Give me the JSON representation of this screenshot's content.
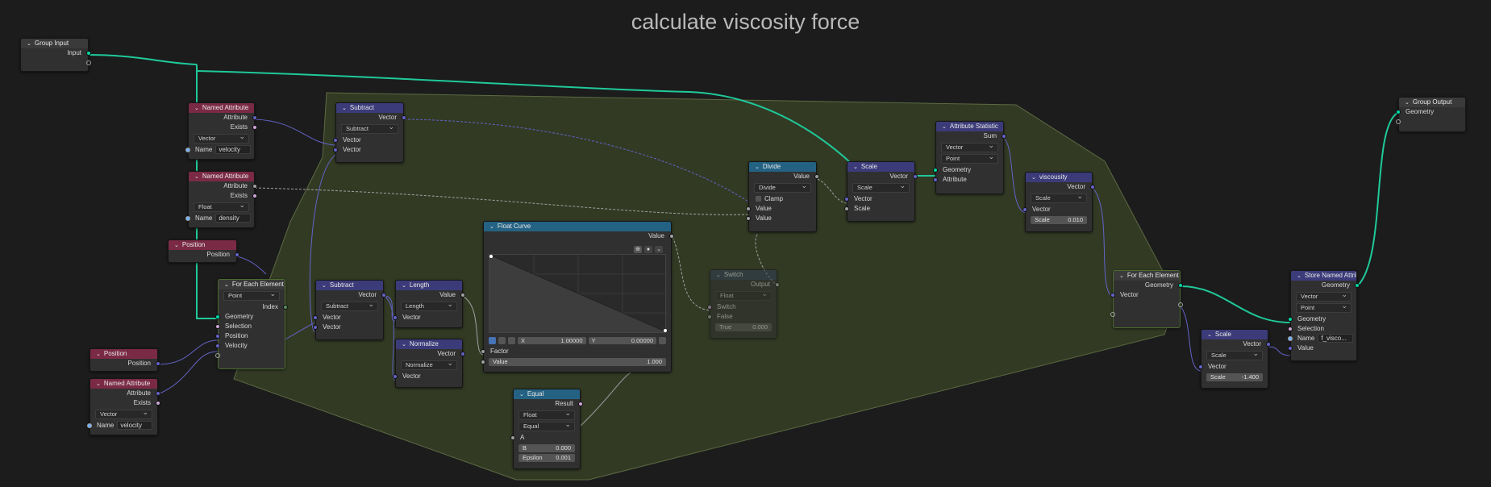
{
  "title": "calculate viscosity force",
  "nodes": {
    "group_input": {
      "header": "Group Input",
      "input_label": "Input"
    },
    "group_output": {
      "header": "Group Output",
      "geometry_label": "Geometry"
    },
    "named_attr_1": {
      "header": "Named Attribute",
      "attribute_label": "Attribute",
      "exists_label": "Exists",
      "type_value": "Vector",
      "name_label": "Name",
      "name_value": "velocity"
    },
    "named_attr_2": {
      "header": "Named Attribute",
      "attribute_label": "Attribute",
      "exists_label": "Exists",
      "type_value": "Float",
      "name_label": "Name",
      "name_value": "density"
    },
    "named_attr_3": {
      "header": "Named Attribute",
      "attribute_label": "Attribute",
      "exists_label": "Exists",
      "type_value": "Vector",
      "name_label": "Name",
      "name_value": "velocity"
    },
    "position_1": {
      "header": "Position",
      "position_label": "Position"
    },
    "position_2": {
      "header": "Position",
      "position_label": "Position"
    },
    "for_each_1": {
      "header": "For Each Element",
      "domain_value": "Point",
      "index_label": "Index",
      "geometry_label": "Geometry",
      "selection_label": "Selection",
      "position_label": "Position",
      "velocity_label": "Velocity"
    },
    "subtract_1": {
      "header": "Subtract",
      "vector_out": "Vector",
      "op_value": "Subtract",
      "vector_a": "Vector",
      "vector_b": "Vector"
    },
    "subtract_2": {
      "header": "Subtract",
      "vector_out": "Vector",
      "op_value": "Subtract",
      "vector_a": "Vector",
      "vector_b": "Vector"
    },
    "length": {
      "header": "Length",
      "value_out": "Value",
      "op_value": "Length",
      "vector_in": "Vector"
    },
    "normalize": {
      "header": "Normalize",
      "vector_out": "Vector",
      "op_value": "Normalize",
      "vector_in": "Vector"
    },
    "float_curve": {
      "header": "Float Curve",
      "value_out": "Value",
      "x_label": "X",
      "x_value": "1.00000",
      "y_label": "Y",
      "y_value": "0.00000",
      "factor_label": "Factor",
      "value_label": "Value",
      "value_value": "1.000"
    },
    "equal": {
      "header": "Equal",
      "result_label": "Result",
      "type_value": "Float",
      "op_value": "Equal",
      "a_label": "A",
      "b_label": "B",
      "b_value": "0.000",
      "eps_label": "Epsilon",
      "eps_value": "0.001"
    },
    "switch": {
      "header": "Switch",
      "output_label": "Output",
      "type_value": "Float",
      "switch_label": "Switch",
      "false_label": "False",
      "true_label": "True",
      "true_value": "0.000"
    },
    "divide": {
      "header": "Divide",
      "value_out": "Value",
      "op_value": "Divide",
      "clamp_label": "Clamp",
      "value_a": "Value",
      "value_b": "Value"
    },
    "scale_1": {
      "header": "Scale",
      "vector_out": "Vector",
      "op_value": "Scale",
      "vector_in": "Vector",
      "scale_label": "Scale"
    },
    "attr_stat": {
      "header": "Attribute Statistic",
      "sum_label": "Sum",
      "type_value": "Vector",
      "domain_value": "Point",
      "geometry_label": "Geometry",
      "attribute_label": "Attribute"
    },
    "viscosity": {
      "header": "viscousity",
      "vector_out": "Vector",
      "op_value": "Scale",
      "vector_in": "Vector",
      "scale_label": "Scale",
      "scale_value": "0.010"
    },
    "for_each_2": {
      "header": "For Each Element",
      "geometry_label": "Geometry",
      "vector_label": "Vector"
    },
    "scale_2": {
      "header": "Scale",
      "vector_out": "Vector",
      "op_value": "Scale",
      "vector_in": "Vector",
      "scale_label": "Scale",
      "scale_value": "-1.400"
    },
    "store_named": {
      "header": "Store Named Attrib...",
      "geometry_out": "Geometry",
      "type_value": "Vector",
      "domain_value": "Point",
      "geometry_in": "Geometry",
      "selection_label": "Selection",
      "name_label": "Name",
      "name_value": "f_visco...",
      "value_label": "Value"
    }
  },
  "colors": {
    "geometry_socket": "#00d6a3",
    "vector_socket": "#6363c7",
    "float_socket": "#a1a1a1",
    "input_header": "#7a2a45",
    "geometry_header": "#3b3b7a",
    "converter_header": "#246283",
    "frame_fill": "#323a24"
  }
}
